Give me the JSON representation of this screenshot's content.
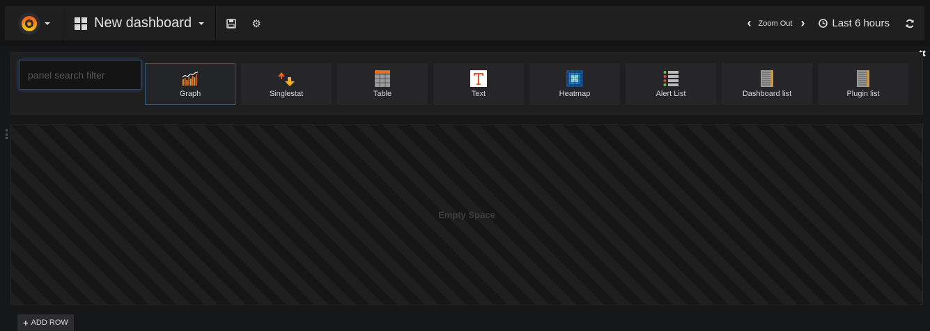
{
  "navbar": {
    "dashboard_title": "New dashboard",
    "zoom_out_label": "Zoom Out",
    "time_range_label": "Last 6 hours"
  },
  "picker": {
    "search_placeholder": "panel search filter",
    "panel_types": [
      {
        "label": "Graph",
        "icon": "graph-icon",
        "selected": true
      },
      {
        "label": "Singlestat",
        "icon": "singlestat-icon"
      },
      {
        "label": "Table",
        "icon": "table-icon"
      },
      {
        "label": "Text",
        "icon": "text-icon"
      },
      {
        "label": "Heatmap",
        "icon": "heatmap-icon"
      },
      {
        "label": "Alert List",
        "icon": "alert-list-icon"
      },
      {
        "label": "Dashboard list",
        "icon": "dashboard-list-icon"
      },
      {
        "label": "Plugin list",
        "icon": "plugin-list-icon"
      }
    ]
  },
  "empty_space_label": "Empty Space",
  "add_row_label": "ADD ROW",
  "colors": {
    "accent_orange": "#eb7b18",
    "bg": "#161719",
    "panel_bg": "#1f1f20"
  }
}
